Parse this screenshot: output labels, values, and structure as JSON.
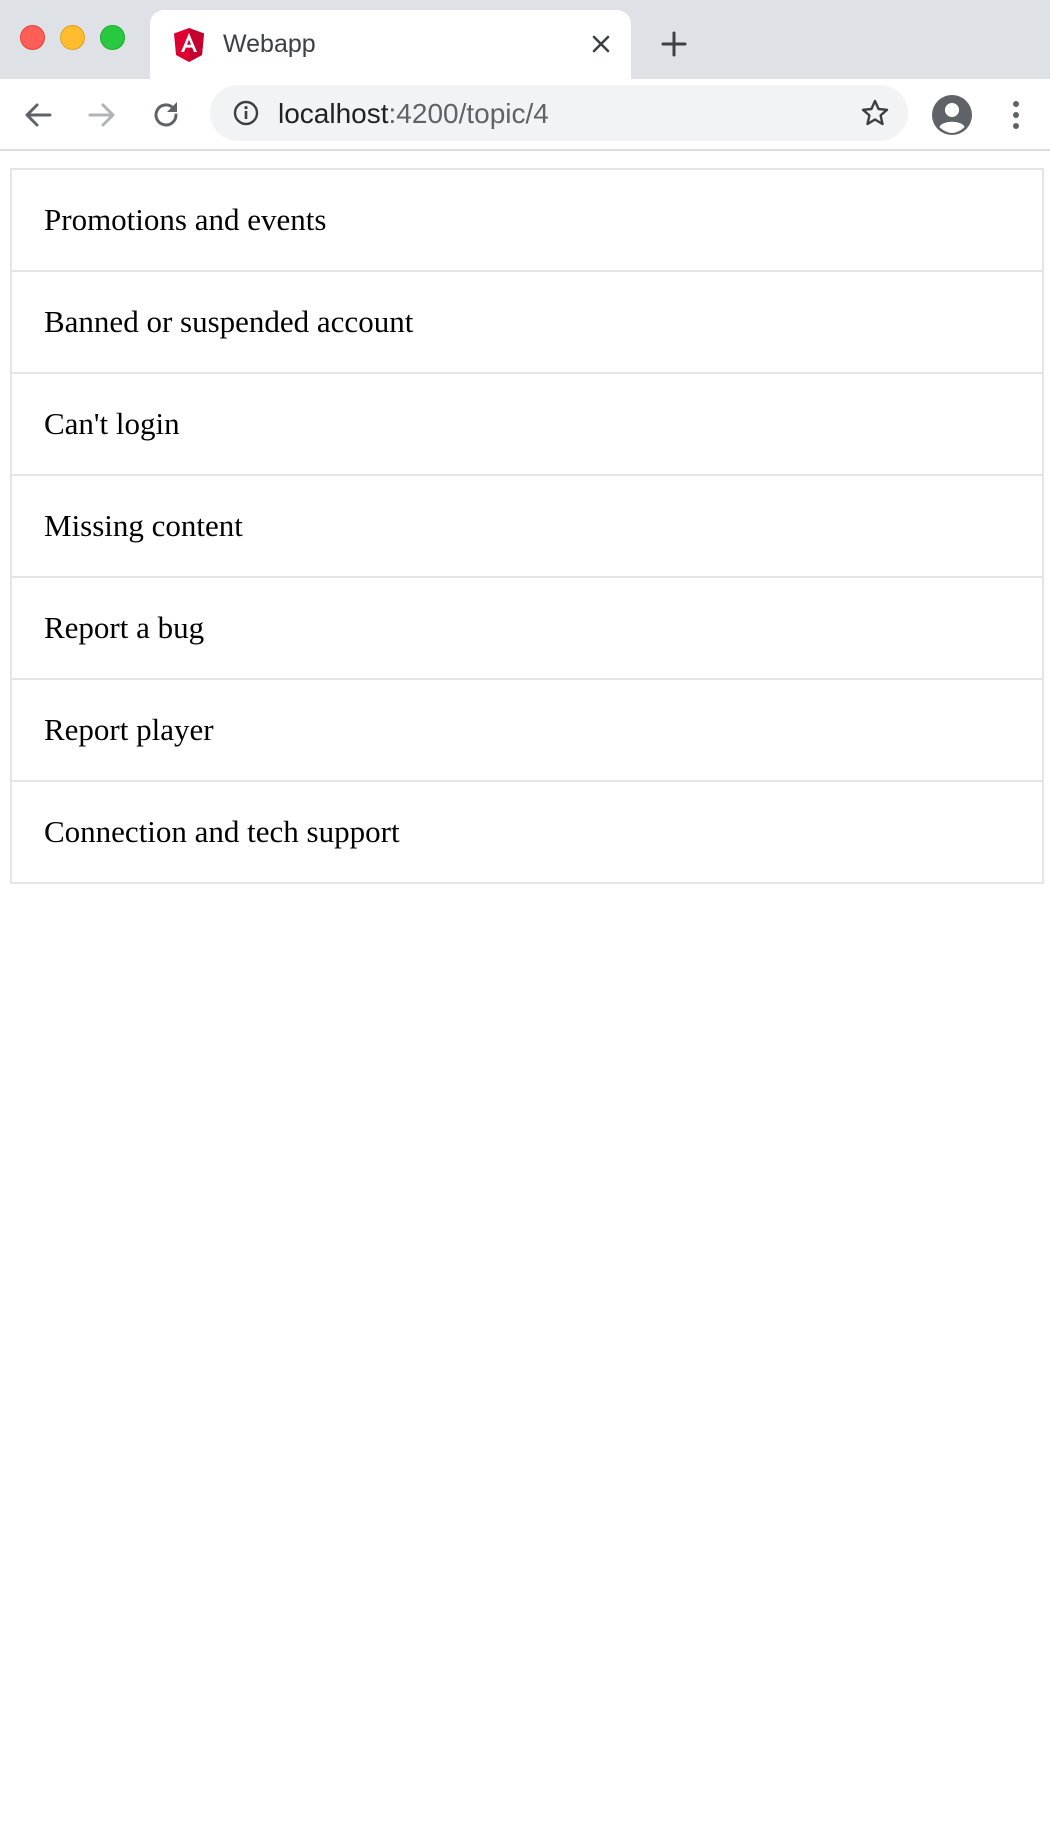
{
  "browser": {
    "tab": {
      "title": "Webapp",
      "favicon": "angular-logo-icon"
    },
    "address_bar": {
      "host": "localhost",
      "rest": ":4200/topic/4"
    },
    "icons": {
      "back": "back-arrow-icon",
      "forward": "forward-arrow-icon",
      "reload": "reload-icon",
      "info": "info-icon",
      "bookmark": "star-icon",
      "profile": "profile-icon",
      "menu": "kebab-menu-icon",
      "new_tab": "plus-icon",
      "close_tab": "close-icon"
    },
    "colors": {
      "tab_strip": "#dee1e6",
      "omnibox": "#f1f3f4",
      "close_light": "#ff5f57",
      "minimize_light": "#febc2e",
      "maximize_light": "#28c840",
      "angular_red": "#dd0031"
    }
  },
  "topics": {
    "items": [
      {
        "label": "Promotions and events"
      },
      {
        "label": "Banned or suspended account"
      },
      {
        "label": "Can't login"
      },
      {
        "label": "Missing content"
      },
      {
        "label": "Report a bug"
      },
      {
        "label": "Report player"
      },
      {
        "label": "Connection and tech support"
      }
    ]
  }
}
